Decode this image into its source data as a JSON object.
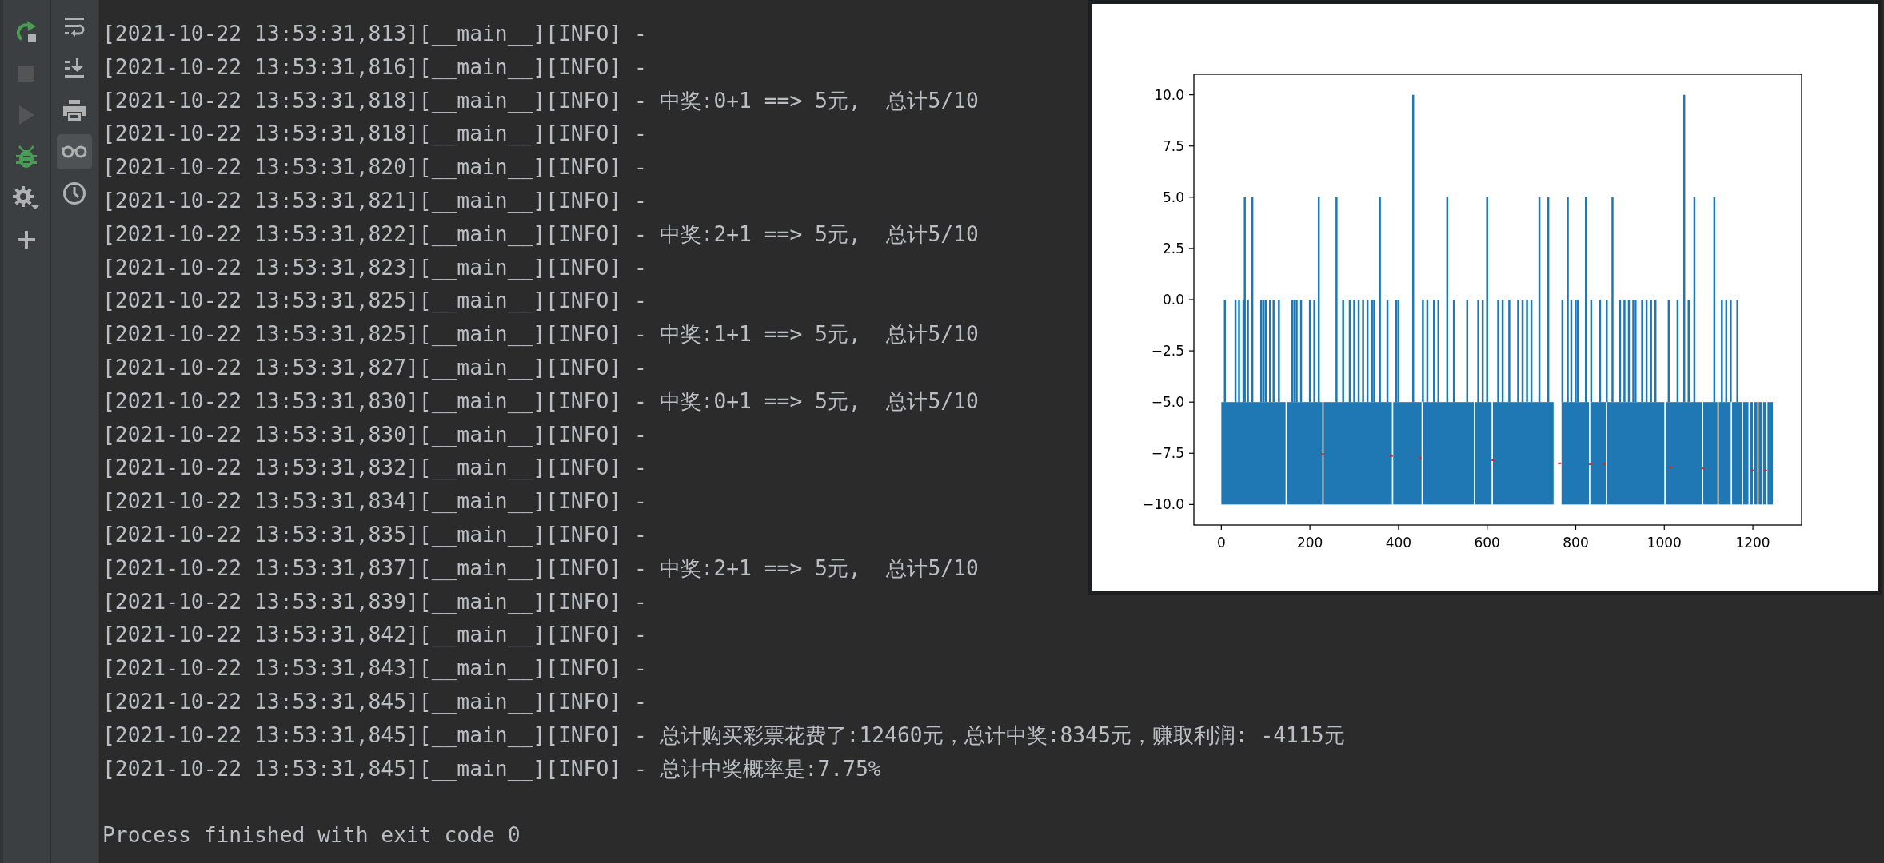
{
  "run_toolbar": [
    {
      "kind": "rerun",
      "disabled": false
    },
    {
      "kind": "stop",
      "disabled": true
    },
    {
      "kind": "play",
      "disabled": true
    },
    {
      "kind": "debug",
      "disabled": false
    },
    {
      "kind": "settings",
      "disabled": false
    },
    {
      "kind": "add",
      "disabled": false
    }
  ],
  "console_toolbar": [
    {
      "kind": "wrap",
      "selected": false
    },
    {
      "kind": "scroll-end",
      "selected": false
    },
    {
      "kind": "print",
      "selected": false
    },
    {
      "kind": "glasses",
      "selected": true
    },
    {
      "kind": "history",
      "selected": false
    }
  ],
  "console": {
    "lines": [
      "[2021-10-22 13:53:31,813][__main__][INFO] -",
      "[2021-10-22 13:53:31,816][__main__][INFO] -",
      "[2021-10-22 13:53:31,818][__main__][INFO] - 中奖:0+1 ==> 5元,  总计5/10",
      "[2021-10-22 13:53:31,818][__main__][INFO] -",
      "[2021-10-22 13:53:31,820][__main__][INFO] -",
      "[2021-10-22 13:53:31,821][__main__][INFO] -",
      "[2021-10-22 13:53:31,822][__main__][INFO] - 中奖:2+1 ==> 5元,  总计5/10",
      "[2021-10-22 13:53:31,823][__main__][INFO] -",
      "[2021-10-22 13:53:31,825][__main__][INFO] -",
      "[2021-10-22 13:53:31,825][__main__][INFO] - 中奖:1+1 ==> 5元,  总计5/10",
      "[2021-10-22 13:53:31,827][__main__][INFO] -",
      "[2021-10-22 13:53:31,830][__main__][INFO] - 中奖:0+1 ==> 5元,  总计5/10",
      "[2021-10-22 13:53:31,830][__main__][INFO] -",
      "[2021-10-22 13:53:31,832][__main__][INFO] -",
      "[2021-10-22 13:53:31,834][__main__][INFO] -",
      "[2021-10-22 13:53:31,835][__main__][INFO] -",
      "[2021-10-22 13:53:31,837][__main__][INFO] - 中奖:2+1 ==> 5元,  总计5/10",
      "[2021-10-22 13:53:31,839][__main__][INFO] -",
      "[2021-10-22 13:53:31,842][__main__][INFO] -",
      "[2021-10-22 13:53:31,843][__main__][INFO] -",
      "[2021-10-22 13:53:31,845][__main__][INFO] -",
      "[2021-10-22 13:53:31,845][__main__][INFO] - 总计购买彩票花费了:12460元，总计中奖:8345元，赚取利润: -4115元",
      "[2021-10-22 13:53:31,845][__main__][INFO] - 总计中奖概率是:7.75%"
    ],
    "exit_message": "Process finished with exit code 0"
  },
  "plot_window": {
    "y_tick_labels": [
      "10.0",
      "7.5",
      "5.0",
      "2.5",
      "0.0",
      "−2.5",
      "−5.0",
      "−7.5",
      "−10.0"
    ],
    "x_tick_labels": [
      "0",
      "200",
      "400",
      "600",
      "800",
      "1000",
      "1200"
    ]
  }
}
